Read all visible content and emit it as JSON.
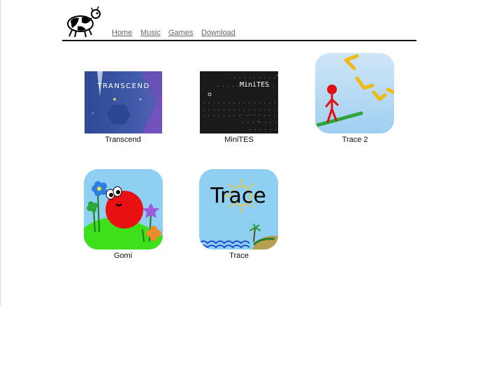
{
  "nav": {
    "home": "Home",
    "music": "Music",
    "games": "Games",
    "download": "Download"
  },
  "games": [
    {
      "title": "Transcend",
      "thumb_text": "TRANSCEND",
      "icon": "transcend-thumbnail"
    },
    {
      "title": "MiniTES",
      "thumb_text": "MiniTES",
      "icon": "minites-thumbnail"
    },
    {
      "title": "Trace 2",
      "icon": "trace2-thumbnail"
    },
    {
      "title": "Gomi",
      "icon": "gomi-thumbnail"
    },
    {
      "title": "Trace",
      "thumb_text": "Trace",
      "icon": "trace-thumbnail"
    }
  ],
  "colors": {
    "nav_link": "#666666",
    "rule": "#111111",
    "transcend_bg": "#3a4f9a",
    "minites_bg": "#1a1a1a",
    "trace_sky": "#8fcff2",
    "gomi_red": "#e81010",
    "gomi_grass": "#3ee01b"
  }
}
